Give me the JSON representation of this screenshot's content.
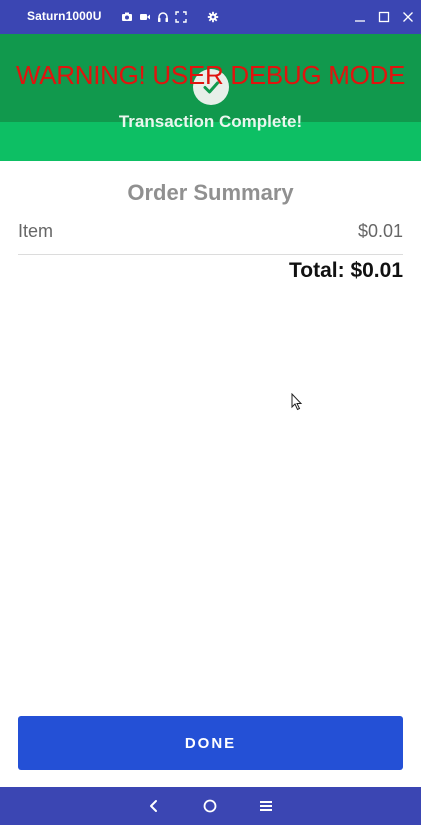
{
  "window": {
    "title": "Saturn1000U",
    "tools": [
      "camera-icon",
      "video-icon",
      "headphones-icon",
      "fullscreen-icon",
      "gear-icon"
    ],
    "controls": [
      "minimize-icon",
      "maximize-icon",
      "close-icon"
    ]
  },
  "banner": {
    "warning": "WARNING! USER DEBUG MODE",
    "status": "Transaction Complete!",
    "icon": "checkmark-icon",
    "colors": {
      "top": "#11994d",
      "bottom": "#0dbf64",
      "warning": "#e0140e"
    }
  },
  "summary": {
    "title": "Order Summary",
    "items": [
      {
        "label": "Item",
        "price": "$0.01"
      }
    ],
    "total": "Total: $0.01"
  },
  "actions": {
    "done_label": "DONE",
    "done_color": "#2450d6"
  },
  "navbar": {
    "buttons": [
      "back-icon",
      "home-icon",
      "menu-icon"
    ],
    "color": "#3b46b3"
  }
}
